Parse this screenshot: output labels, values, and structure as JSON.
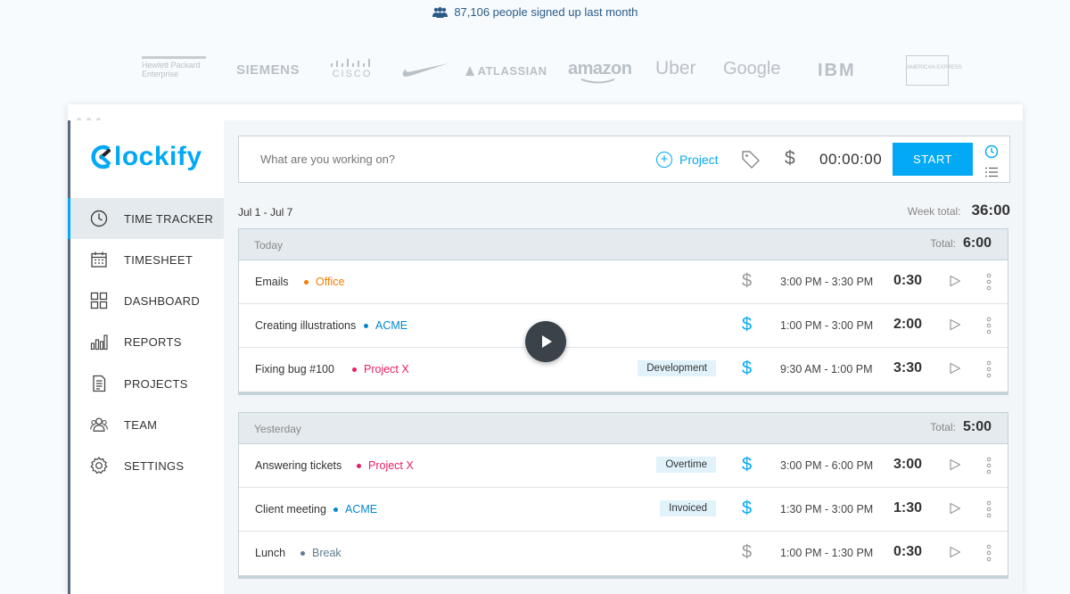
{
  "header": {
    "signup_text": "87,106 people signed up last month"
  },
  "logos": {
    "hpe_line1": "Hewlett Packard",
    "hpe_line2": "Enterprise",
    "siemens": "SIEMENS",
    "cisco": "CISCO",
    "atlassian": "ATLASSIAN",
    "amazon": "amazon",
    "uber": "Uber",
    "google": "Google",
    "ibm": "IBM",
    "amex": "AMERICAN EXPRESS"
  },
  "sidebar": {
    "brand": "lockify",
    "items": [
      {
        "label": "TIME TRACKER",
        "icon": "clock-icon"
      },
      {
        "label": "TIMESHEET",
        "icon": "calendar-icon"
      },
      {
        "label": "DASHBOARD",
        "icon": "dashboard-icon"
      },
      {
        "label": "REPORTS",
        "icon": "bar-chart-icon"
      },
      {
        "label": "PROJECTS",
        "icon": "document-icon"
      },
      {
        "label": "TEAM",
        "icon": "team-icon"
      },
      {
        "label": "SETTINGS",
        "icon": "gear-icon"
      }
    ]
  },
  "timer": {
    "placeholder": "What are you working on?",
    "project_label": "Project",
    "elapsed": "00:00:00",
    "start_label": "START"
  },
  "week": {
    "range": "Jul 1 - Jul 7",
    "total_label": "Week total:",
    "total": "36:00"
  },
  "days": [
    {
      "name": "Today",
      "total_label": "Total:",
      "total": "6:00",
      "entries": [
        {
          "description": "Emails",
          "project": "Office",
          "project_color": "#f57c00",
          "tag": "",
          "billable": false,
          "range": "3:00 PM - 3:30 PM",
          "duration": "0:30"
        },
        {
          "description": "Creating illustrations",
          "project": "ACME",
          "project_color": "#0288d1",
          "tag": "",
          "billable": true,
          "range": "1:00 PM - 3:00 PM",
          "duration": "2:00"
        },
        {
          "description": "Fixing bug #100",
          "project": "Project X",
          "project_color": "#e91e63",
          "tag": "Development",
          "billable": true,
          "range": "9:30 AM - 1:00 PM",
          "duration": "3:30"
        }
      ]
    },
    {
      "name": "Yesterday",
      "total_label": "Total:",
      "total": "5:00",
      "entries": [
        {
          "description": "Answering tickets",
          "project": "Project X",
          "project_color": "#e91e63",
          "tag": "Overtime",
          "billable": true,
          "range": "3:00 PM - 6:00 PM",
          "duration": "3:00"
        },
        {
          "description": "Client meeting",
          "project": "ACME",
          "project_color": "#0288d1",
          "tag": "Invoiced",
          "billable": true,
          "range": "1:30 PM - 3:00 PM",
          "duration": "1:30"
        },
        {
          "description": "Lunch",
          "project": "Break",
          "project_color": "#607d8b",
          "tag": "",
          "billable": false,
          "range": "1:00 PM - 1:30 PM",
          "duration": "0:30"
        }
      ]
    }
  ],
  "colors": {
    "accent": "#03a9f4",
    "billable": "#03a9f4",
    "non_billable": "#999999"
  }
}
